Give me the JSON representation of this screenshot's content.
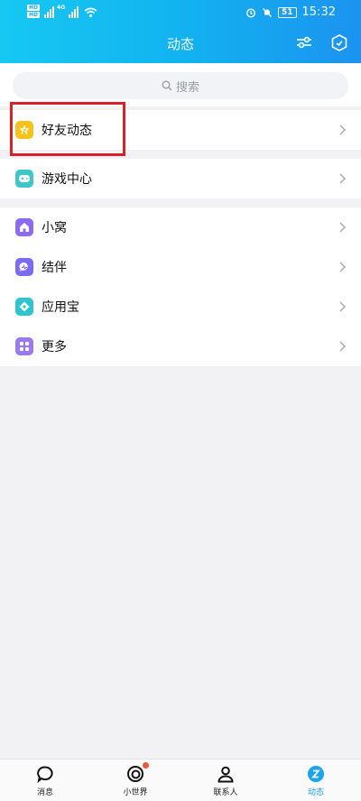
{
  "status_bar": {
    "time": "15:32",
    "battery": "51",
    "network": "4G"
  },
  "header": {
    "title": "动态"
  },
  "search": {
    "placeholder": "搜索"
  },
  "groups": [
    [
      {
        "label": "好友动态",
        "icon": "friends-feed-star-icon",
        "color": "#f6c21b"
      }
    ],
    [
      {
        "label": "游戏中心",
        "icon": "gamepad-icon",
        "color": "#3fc6c9"
      }
    ],
    [
      {
        "label": "小窝",
        "icon": "house-icon",
        "color": "#8b6cf0"
      },
      {
        "label": "结伴",
        "icon": "chat-bubble-icon",
        "color": "#7b6cf3"
      },
      {
        "label": "应用宝",
        "icon": "app-store-icon",
        "color": "#2ec5cf"
      },
      {
        "label": "更多",
        "icon": "grid-icon",
        "color": "#9b79ef"
      }
    ]
  ],
  "tabs": [
    {
      "label": "消息",
      "icon": "message-bubble-icon",
      "active": false
    },
    {
      "label": "小世界",
      "icon": "small-world-icon",
      "active": false,
      "badge": true
    },
    {
      "label": "联系人",
      "icon": "contacts-person-icon",
      "active": false
    },
    {
      "label": "动态",
      "icon": "feed-star-icon",
      "active": true
    }
  ],
  "colors": {
    "accent": "#1aa3f0",
    "highlight": "#d6202a",
    "badge": "#f2543d"
  }
}
